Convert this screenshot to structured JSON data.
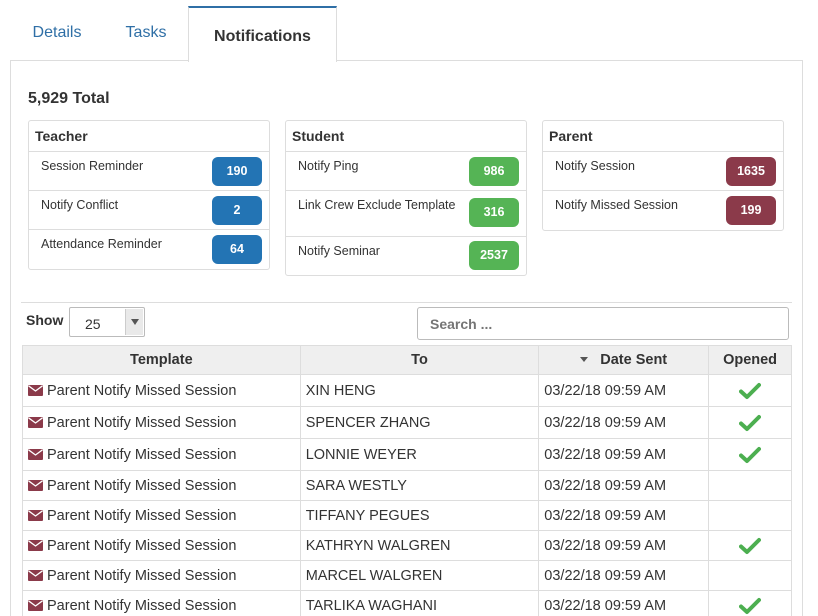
{
  "tabs": [
    {
      "label": "Details"
    },
    {
      "label": "Tasks"
    },
    {
      "label": "Notifications"
    }
  ],
  "total": "5,929 Total",
  "cards": {
    "teacher": {
      "title": "Teacher",
      "rows": [
        {
          "label": "Session Reminder",
          "count": "190"
        },
        {
          "label": "Notify Conflict",
          "count": "2"
        },
        {
          "label": "Attendance Reminder",
          "count": "64"
        }
      ]
    },
    "student": {
      "title": "Student",
      "rows": [
        {
          "label": "Notify Ping",
          "count": "986"
        },
        {
          "label": "Link Crew Exclude Template",
          "count": "316"
        },
        {
          "label": "Notify Seminar",
          "count": "2537"
        }
      ]
    },
    "parent": {
      "title": "Parent",
      "rows": [
        {
          "label": "Notify Session",
          "count": "1635"
        },
        {
          "label": "Notify Missed Session",
          "count": "199"
        }
      ]
    }
  },
  "colors": {
    "teacher_badge": "#2374b4",
    "student_badge": "#55b455",
    "parent_badge": "#8b3a4a",
    "check": "#4caf50",
    "envelope": "#8b3a4a",
    "link": "#2f6fa6"
  },
  "table_controls": {
    "show_label": "Show",
    "page_size": "25",
    "search_placeholder": "Search ..."
  },
  "table": {
    "headers": [
      "Template",
      "To",
      "Date Sent",
      "Opened"
    ],
    "sorted_column": "Date Sent",
    "rows": [
      {
        "template": "Parent Notify Missed Session",
        "to": "XIN HENG",
        "date": "03/22/18 09:59 AM",
        "opened": true
      },
      {
        "template": "Parent Notify Missed Session",
        "to": "SPENCER ZHANG",
        "date": "03/22/18 09:59 AM",
        "opened": true
      },
      {
        "template": "Parent Notify Missed Session",
        "to": "LONNIE WEYER",
        "date": "03/22/18 09:59 AM",
        "opened": true
      },
      {
        "template": "Parent Notify Missed Session",
        "to": "SARA WESTLY",
        "date": "03/22/18 09:59 AM",
        "opened": false
      },
      {
        "template": "Parent Notify Missed Session",
        "to": "TIFFANY PEGUES",
        "date": "03/22/18 09:59 AM",
        "opened": false
      },
      {
        "template": "Parent Notify Missed Session",
        "to": "KATHRYN WALGREN",
        "date": "03/22/18 09:59 AM",
        "opened": true
      },
      {
        "template": "Parent Notify Missed Session",
        "to": "MARCEL WALGREN",
        "date": "03/22/18 09:59 AM",
        "opened": false
      },
      {
        "template": "Parent Notify Missed Session",
        "to": "TARLIKA WAGHANI",
        "date": "03/22/18 09:59 AM",
        "opened": true
      }
    ]
  }
}
